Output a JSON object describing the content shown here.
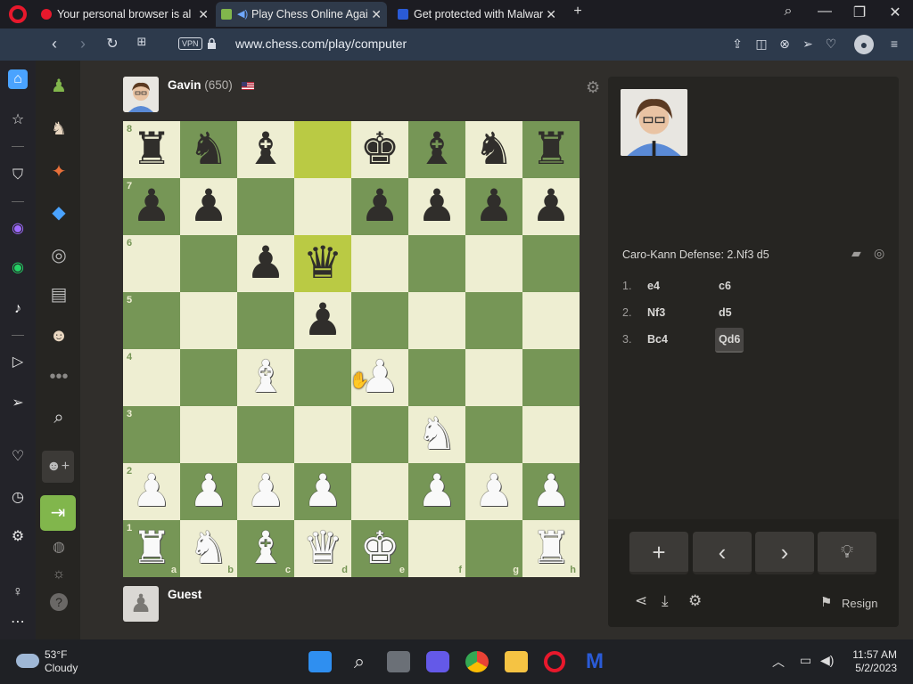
{
  "browser": {
    "tabs": [
      {
        "title": "Your personal browser is al",
        "active": false
      },
      {
        "title": "Play Chess Online Agai",
        "active": true
      },
      {
        "title": "Get protected with Malwar",
        "active": false
      }
    ],
    "new_tab_label": "+",
    "url": "www.chess.com/play/computer",
    "vpn_label": "VPN"
  },
  "game": {
    "opponent": {
      "name": "Gavin",
      "rating": "(650)"
    },
    "player": {
      "name": "Guest"
    },
    "files": [
      "a",
      "b",
      "c",
      "d",
      "e",
      "f",
      "g",
      "h"
    ],
    "ranks": [
      "8",
      "7",
      "6",
      "5",
      "4",
      "3",
      "2",
      "1"
    ],
    "highlighted_squares": [
      "d8",
      "d6"
    ],
    "pieces": [
      {
        "sq": "a8",
        "p": "r"
      },
      {
        "sq": "b8",
        "p": "n"
      },
      {
        "sq": "c8",
        "p": "b"
      },
      {
        "sq": "e8",
        "p": "k"
      },
      {
        "sq": "f8",
        "p": "b"
      },
      {
        "sq": "g8",
        "p": "n"
      },
      {
        "sq": "h8",
        "p": "r"
      },
      {
        "sq": "a7",
        "p": "p"
      },
      {
        "sq": "b7",
        "p": "p"
      },
      {
        "sq": "e7",
        "p": "p"
      },
      {
        "sq": "f7",
        "p": "p"
      },
      {
        "sq": "g7",
        "p": "p"
      },
      {
        "sq": "h7",
        "p": "p"
      },
      {
        "sq": "c6",
        "p": "p"
      },
      {
        "sq": "d6",
        "p": "q"
      },
      {
        "sq": "d5",
        "p": "p"
      },
      {
        "sq": "c4",
        "p": "B"
      },
      {
        "sq": "e4",
        "p": "P"
      },
      {
        "sq": "f3",
        "p": "N"
      },
      {
        "sq": "a2",
        "p": "P"
      },
      {
        "sq": "b2",
        "p": "P"
      },
      {
        "sq": "c2",
        "p": "P"
      },
      {
        "sq": "d2",
        "p": "P"
      },
      {
        "sq": "f2",
        "p": "P"
      },
      {
        "sq": "g2",
        "p": "P"
      },
      {
        "sq": "h2",
        "p": "P"
      },
      {
        "sq": "a1",
        "p": "R"
      },
      {
        "sq": "b1",
        "p": "N"
      },
      {
        "sq": "c1",
        "p": "B"
      },
      {
        "sq": "d1",
        "p": "Q"
      },
      {
        "sq": "e1",
        "p": "K"
      },
      {
        "sq": "h1",
        "p": "R"
      }
    ]
  },
  "panel": {
    "opening": "Caro-Kann Defense: 2.Nf3 d5",
    "moves": [
      {
        "num": "1.",
        "white": "e4",
        "black": "c6"
      },
      {
        "num": "2.",
        "white": "Nf3",
        "black": "d5"
      },
      {
        "num": "3.",
        "white": "Bc4",
        "black": "Qd6"
      }
    ],
    "current_move": "Qd6",
    "resign_label": "Resign"
  },
  "taskbar": {
    "temperature": "53°F",
    "condition": "Cloudy",
    "time": "11:57 AM",
    "date": "5/2/2023"
  },
  "colors": {
    "light_square": "#eeeed2",
    "dark_square": "#769656",
    "highlight": "#baca44",
    "accent_green": "#81b64c"
  }
}
